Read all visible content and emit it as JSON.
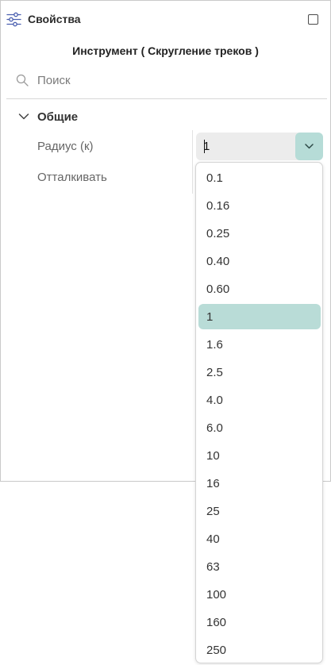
{
  "panel": {
    "title": "Свойства",
    "icon": "sliders-icon",
    "maximize_icon": "maximize-icon"
  },
  "tool_title": "Инструмент ( Скругление треков )",
  "search": {
    "placeholder": "Поиск",
    "icon": "search-icon"
  },
  "section": {
    "label": "Общие",
    "expanded": true
  },
  "properties": [
    {
      "label": "Радиус (к)",
      "value": "1"
    },
    {
      "label": "Отталкивать",
      "value": ""
    }
  ],
  "dropdown": {
    "selected": "1",
    "options": [
      "0.1",
      "0.16",
      "0.25",
      "0.40",
      "0.60",
      "1",
      "1.6",
      "2.5",
      "4.0",
      "6.0",
      "10",
      "16",
      "25",
      "40",
      "63",
      "100",
      "160",
      "250"
    ]
  },
  "colors": {
    "accent": "#b6dcd7",
    "selected_bg": "#b9dcd7",
    "field_bg": "#ececec"
  }
}
